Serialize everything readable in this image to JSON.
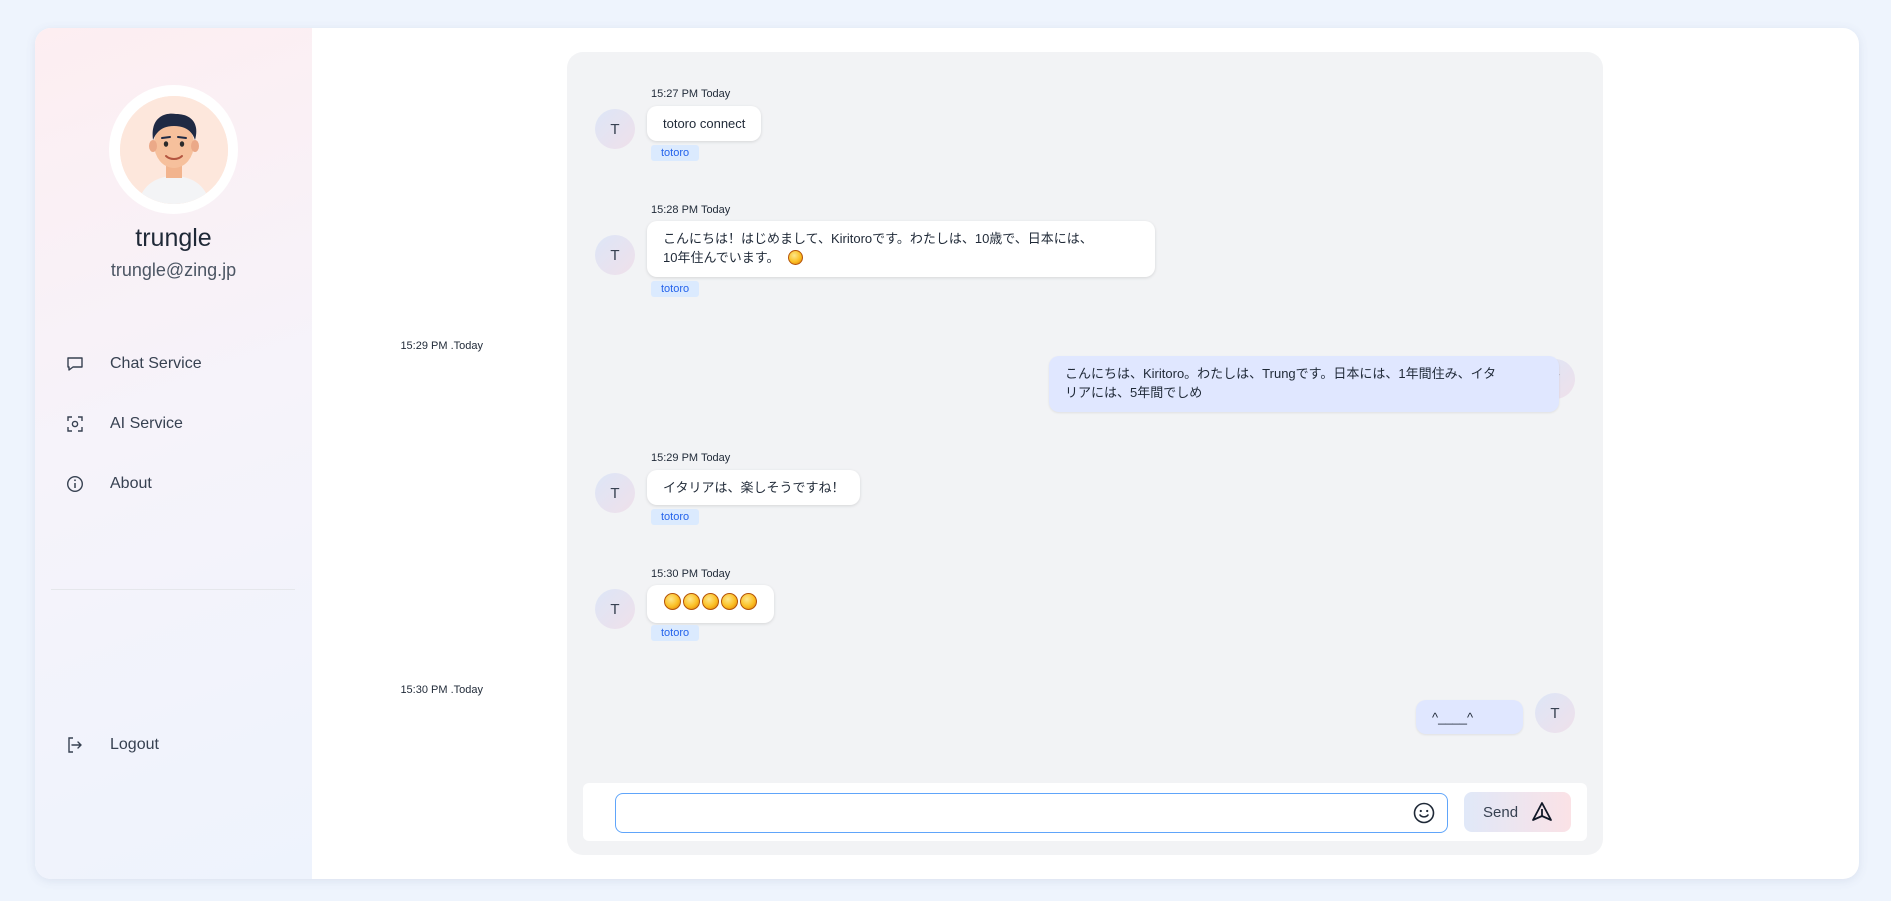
{
  "user": {
    "name": "trungle",
    "email": "trungle@zing.jp"
  },
  "nav": {
    "items": [
      {
        "label": "Chat Service",
        "icon": "chat-bubble-icon"
      },
      {
        "label": "AI Service",
        "icon": "face-scan-icon"
      },
      {
        "label": "About",
        "icon": "info-icon"
      }
    ],
    "logout_label": "Logout"
  },
  "chat": {
    "messages": [
      {
        "from": "other",
        "avatar": "T",
        "time": "15:27 PM Today",
        "text": "totoro connect",
        "tag": "totoro"
      },
      {
        "from": "other",
        "avatar": "T",
        "time": "15:28 PM Today",
        "text_line1": "こんにちは！はじめまして、Kiritoroです。わたしは、10歳で、日本には、",
        "text_line2": "10年住んでいます。",
        "emoji": "grinning-tongue-emoji",
        "tag": "totoro"
      },
      {
        "from": "me",
        "avatar": "T",
        "time": "15:29 PM .Today",
        "text_line1": "こんにちは、Kiritoro。わたしは、Trungです。日本には、1年間住み、イタ",
        "text_line2": "リアには、5年間でしめ"
      },
      {
        "from": "other",
        "avatar": "T",
        "time": "15:29 PM Today",
        "text": "イタリアは、楽しそうですね！",
        "tag": "totoro"
      },
      {
        "from": "other",
        "avatar": "T",
        "time": "15:30 PM Today",
        "emoji": "smiling-face-emoji",
        "emoji_count": 5,
        "tag": "totoro"
      },
      {
        "from": "me",
        "avatar": "T",
        "time": "15:30 PM .Today",
        "text": "^____^"
      }
    ]
  },
  "composer": {
    "input_value": "",
    "emoji_icon": "smiley-icon",
    "send_label": "Send",
    "send_icon": "send-triangle-icon"
  },
  "colors": {
    "background": "#eef4fd",
    "chat_panel": "#f2f3f5",
    "my_bubble": "#e0e7ff",
    "tag_text": "#2563eb",
    "tag_bg": "#dbeafe",
    "input_border": "#60a5fa"
  }
}
